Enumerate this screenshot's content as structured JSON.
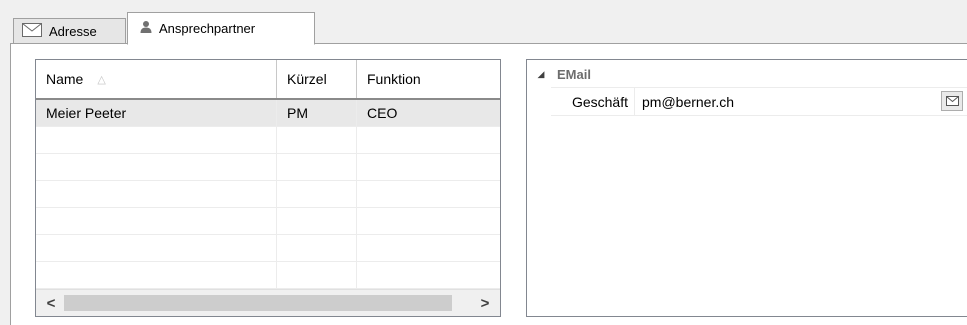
{
  "tabs": [
    {
      "label": "Adresse",
      "icon": "envelope-icon",
      "selected": false
    },
    {
      "label": "Ansprechpartner",
      "icon": "person-icon",
      "selected": true
    }
  ],
  "contacts_grid": {
    "columns": [
      "Name",
      "Kürzel",
      "Funktion"
    ],
    "sort_column": "Name",
    "sort_direction": "ascending",
    "rows": [
      {
        "name": "Meier Peeter",
        "kuerzel": "PM",
        "funktion": "CEO",
        "selected": true
      }
    ],
    "scroll_left_glyph": "<",
    "scroll_right_glyph": ">"
  },
  "properties": {
    "category": "EMail",
    "items": [
      {
        "name": "Geschäft",
        "value": "pm@berner.ch",
        "button_icon": "envelope-icon"
      }
    ]
  },
  "colors": {
    "selected_row": "#e8e8e8",
    "category_text": "#6d6d6d",
    "border": "#828790"
  }
}
